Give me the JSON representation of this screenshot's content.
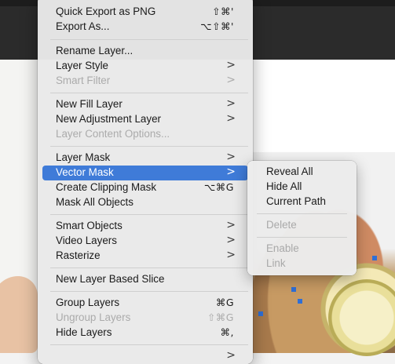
{
  "menu": {
    "items": [
      {
        "label": "Quick Export as PNG",
        "shortcut": "⇧⌘'",
        "submenu": false,
        "disabled": false
      },
      {
        "label": "Export As...",
        "shortcut": "⌥⇧⌘'",
        "submenu": false,
        "disabled": false
      },
      {
        "label": "Rename Layer...",
        "shortcut": "",
        "submenu": false,
        "disabled": false
      },
      {
        "label": "Layer Style",
        "shortcut": "",
        "submenu": true,
        "disabled": false
      },
      {
        "label": "Smart Filter",
        "shortcut": "",
        "submenu": true,
        "disabled": true
      },
      {
        "label": "New Fill Layer",
        "shortcut": "",
        "submenu": true,
        "disabled": false
      },
      {
        "label": "New Adjustment Layer",
        "shortcut": "",
        "submenu": true,
        "disabled": false
      },
      {
        "label": "Layer Content Options...",
        "shortcut": "",
        "submenu": false,
        "disabled": true
      },
      {
        "label": "Layer Mask",
        "shortcut": "",
        "submenu": true,
        "disabled": false
      },
      {
        "label": "Vector Mask",
        "shortcut": "",
        "submenu": true,
        "disabled": false,
        "highlighted": true
      },
      {
        "label": "Create Clipping Mask",
        "shortcut": "⌥⌘G",
        "submenu": false,
        "disabled": false
      },
      {
        "label": "Mask All Objects",
        "shortcut": "",
        "submenu": false,
        "disabled": false
      },
      {
        "label": "Smart Objects",
        "shortcut": "",
        "submenu": true,
        "disabled": false
      },
      {
        "label": "Video Layers",
        "shortcut": "",
        "submenu": true,
        "disabled": false
      },
      {
        "label": "Rasterize",
        "shortcut": "",
        "submenu": true,
        "disabled": false
      },
      {
        "label": "New Layer Based Slice",
        "shortcut": "",
        "submenu": false,
        "disabled": false
      },
      {
        "label": "Group Layers",
        "shortcut": "⌘G",
        "submenu": false,
        "disabled": false
      },
      {
        "label": "Ungroup Layers",
        "shortcut": "⇧⌘G",
        "submenu": false,
        "disabled": true
      },
      {
        "label": "Hide Layers",
        "shortcut": "⌘,",
        "submenu": false,
        "disabled": false
      }
    ],
    "arrow_glyph": ">"
  },
  "submenu": {
    "items": [
      {
        "label": "Reveal All",
        "disabled": false
      },
      {
        "label": "Hide All",
        "disabled": false
      },
      {
        "label": "Current Path",
        "disabled": false
      },
      {
        "label": "Delete",
        "disabled": true
      },
      {
        "label": "Enable",
        "disabled": true
      },
      {
        "label": "Link",
        "disabled": true
      }
    ]
  },
  "colors": {
    "highlight": "#3f7bd8",
    "anchor": "#2f6fd6",
    "disabled_text": "#ababab"
  }
}
